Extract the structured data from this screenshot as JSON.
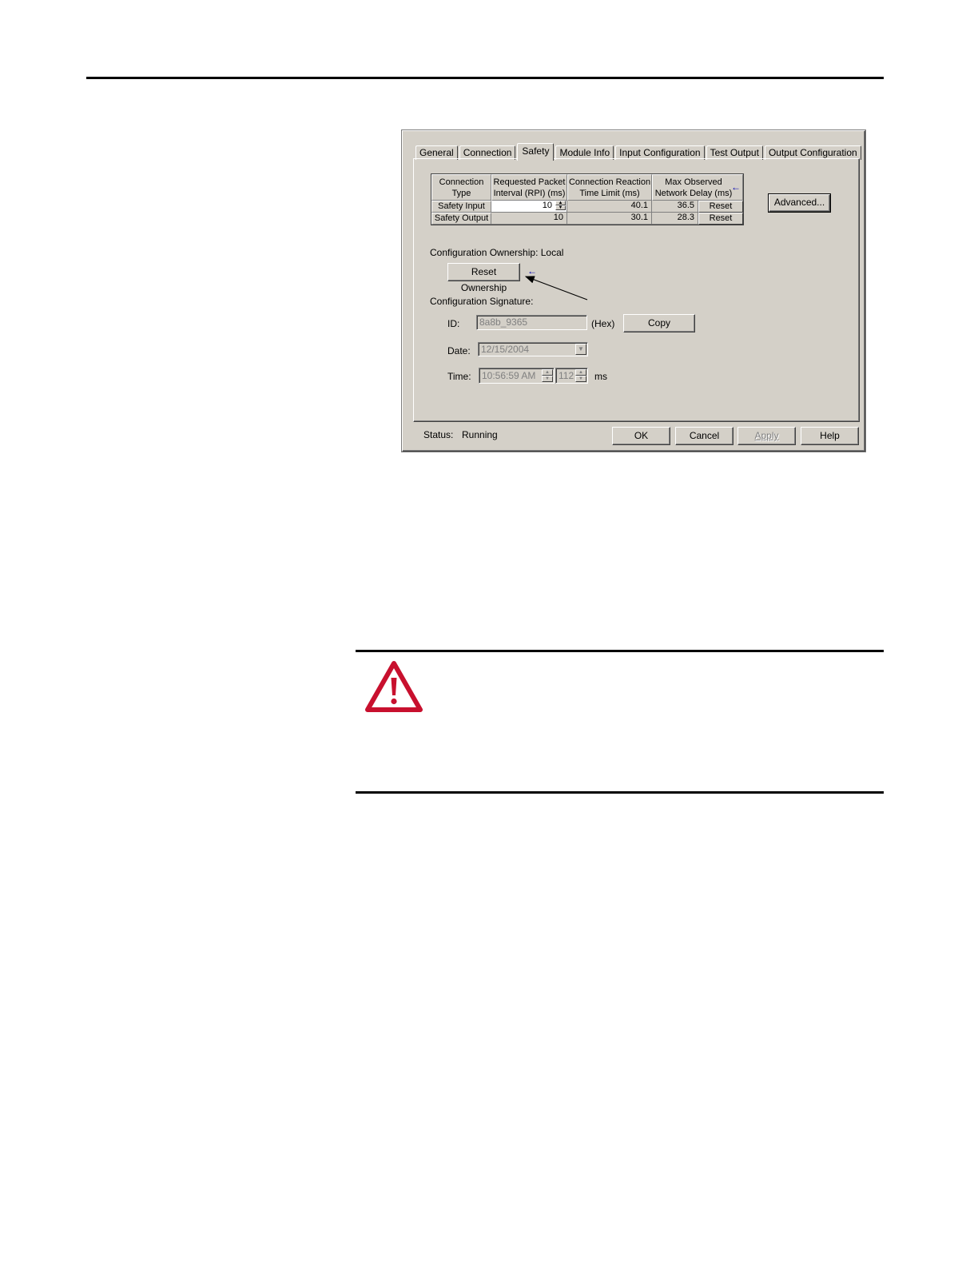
{
  "dialog": {
    "tabs": [
      "General",
      "Connection",
      "Safety",
      "Module Info",
      "Input Configuration",
      "Test Output",
      "Output Configuration"
    ],
    "active_tab": "Safety",
    "grid": {
      "headers": [
        "Connection Type",
        "Requested Packet Interval (RPI) (ms)",
        "Connection Reaction Time Limit (ms)",
        "Max Observed Network Delay (ms)"
      ],
      "rows": [
        {
          "type": "Safety Input",
          "rpi": "10",
          "reaction": "40.1",
          "delay": "36.5",
          "reset": "Reset"
        },
        {
          "type": "Safety Output",
          "rpi": "10",
          "reaction": "30.1",
          "delay": "28.3",
          "reset": "Reset"
        }
      ],
      "arrow_glyph": "←"
    },
    "advanced_label": "Advanced...",
    "ownership_label": "Configuration Ownership: Local",
    "reset_ownership_label": "Reset Ownership",
    "ownership_arrow_glyph": "←",
    "signature_label": "Configuration Signature:",
    "id_label": "ID:",
    "id_value": "8a8b_9365",
    "hex_label": "(Hex)",
    "copy_label": "Copy",
    "date_label": "Date:",
    "date_value": "12/15/2004",
    "time_label": "Time:",
    "time_value": "10:56:59 AM",
    "ms_value": "112",
    "ms_label": "ms",
    "status_label": "Status:",
    "status_value": "Running",
    "buttons": {
      "ok": "OK",
      "cancel": "Cancel",
      "apply": "Apply",
      "help": "Help"
    }
  },
  "colors": {
    "dialog_bg": "#d4d0c8",
    "warning_red": "#c8102e",
    "arrow_blue": "#0000b0"
  },
  "icons": {
    "warning": "warning-triangle-icon"
  }
}
